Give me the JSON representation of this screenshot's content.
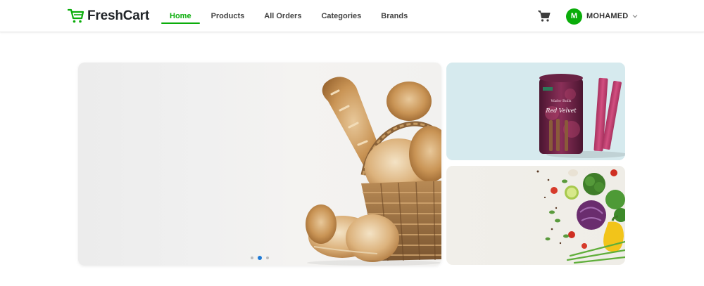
{
  "brand": {
    "name": "FreshCart",
    "icon": "cart-logo-icon",
    "accent": "#0aad0a"
  },
  "nav": {
    "items": [
      {
        "label": "Home",
        "active": true
      },
      {
        "label": "Products",
        "active": false
      },
      {
        "label": "All Orders",
        "active": false
      },
      {
        "label": "Categories",
        "active": false
      },
      {
        "label": "Brands",
        "active": false
      }
    ]
  },
  "header": {
    "cart_icon": "cart-icon",
    "user": {
      "initial": "M",
      "name": "MOHAMED",
      "menu_icon": "chevron-down-icon"
    }
  },
  "slider": {
    "slides": 3,
    "active_index": 1,
    "image": "bread-basket-image",
    "dot_color": "#1e7ad6"
  },
  "side_banners": [
    {
      "image": "wafer-rolls-image",
      "product_text": [
        "Wafer Rolls",
        "Red Velvet"
      ]
    },
    {
      "image": "vegetables-image"
    }
  ]
}
